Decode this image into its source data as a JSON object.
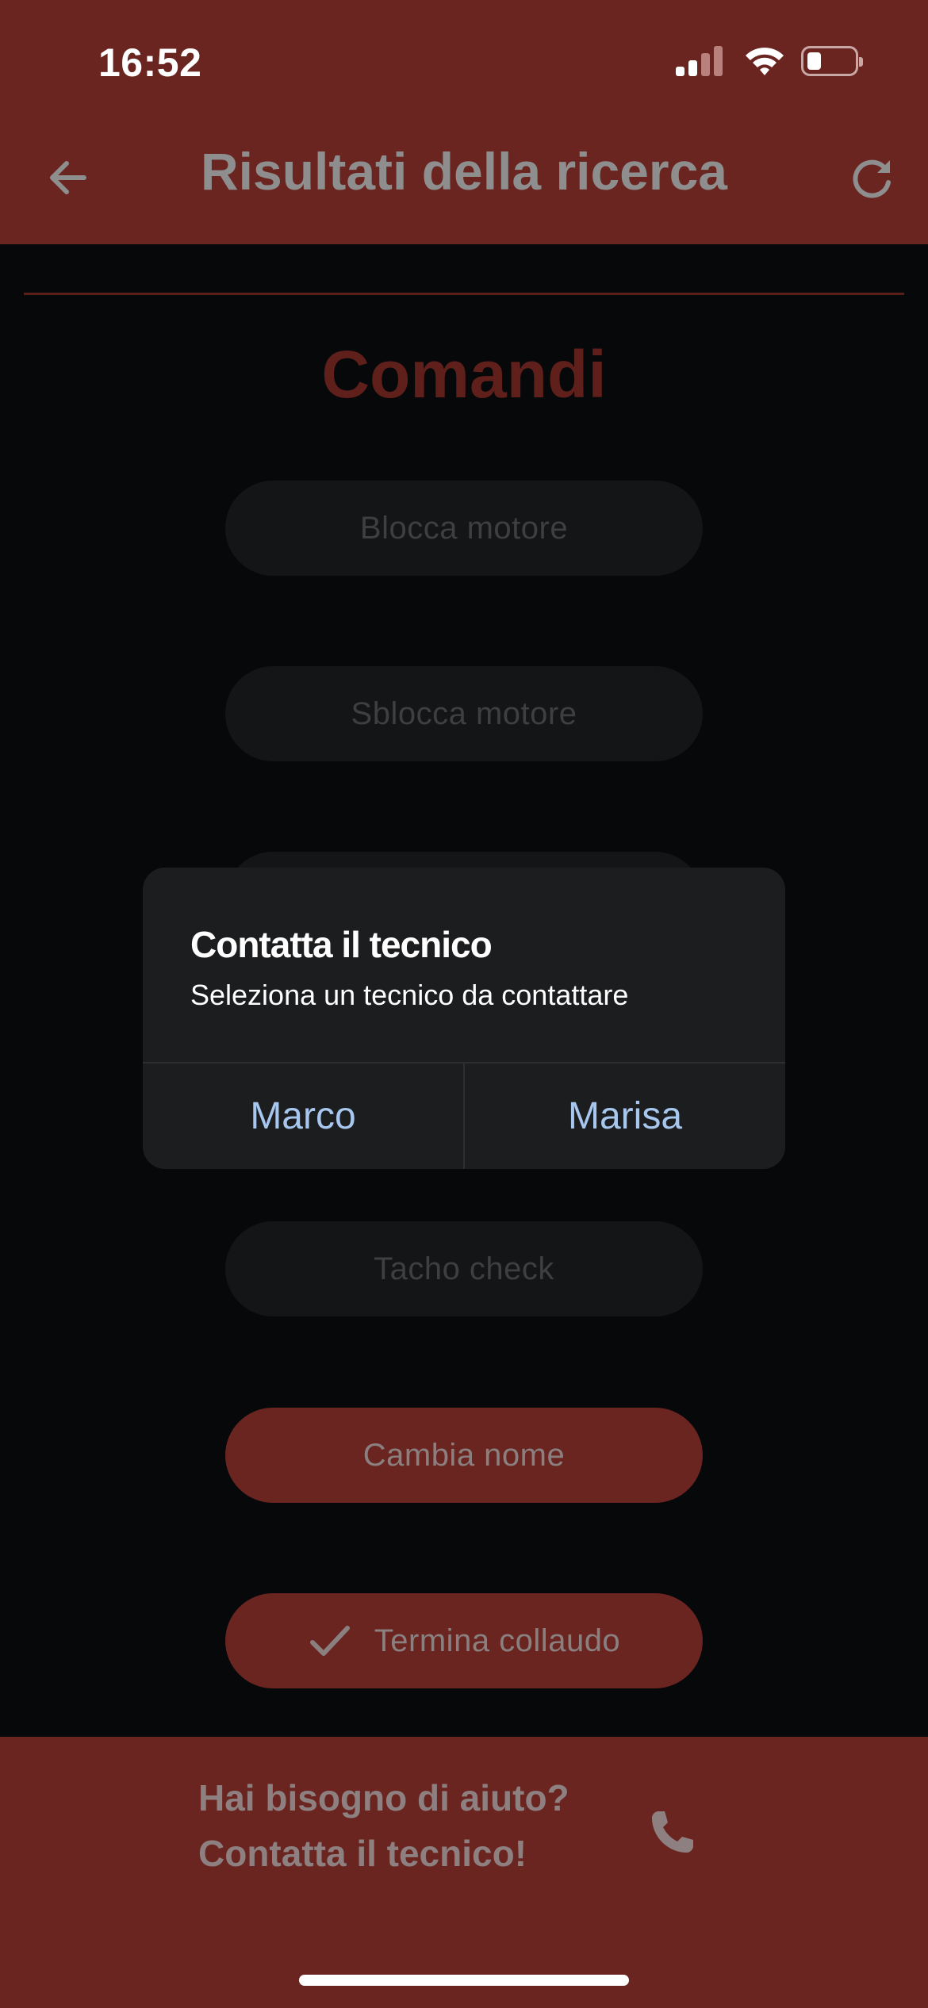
{
  "status_bar": {
    "time": "16:52",
    "icons": [
      "cellular-signal-icon",
      "wifi-icon",
      "battery-icon"
    ],
    "battery_level": 0.25
  },
  "app_bar": {
    "title": "Risultati della ricerca",
    "back_icon": "arrow-left-icon",
    "refresh_icon": "refresh-icon"
  },
  "content": {
    "section_title": "Comandi",
    "commands": [
      {
        "label": "Blocca motore",
        "enabled": false
      },
      {
        "label": "Sblocca motore",
        "enabled": false
      },
      {
        "label": "",
        "enabled": false
      },
      {
        "label": "Tacho check",
        "enabled": false
      },
      {
        "label": "Cambia nome",
        "enabled": true
      },
      {
        "label": "Termina collaudo",
        "enabled": true,
        "icon": "check-icon"
      }
    ]
  },
  "help_bar": {
    "line1": "Hai bisogno di aiuto?",
    "line2": "Contatta il tecnico!",
    "icon": "phone-icon"
  },
  "dialog": {
    "title": "Contatta il tecnico",
    "message": "Seleziona un tecnico da contattare",
    "buttons": [
      "Marco",
      "Marisa"
    ]
  },
  "colors": {
    "brand_red": "#6a2520",
    "background": "#07080a",
    "dialog_bg": "#1c1d1e",
    "dialog_button_text": "#a7c7ef"
  }
}
